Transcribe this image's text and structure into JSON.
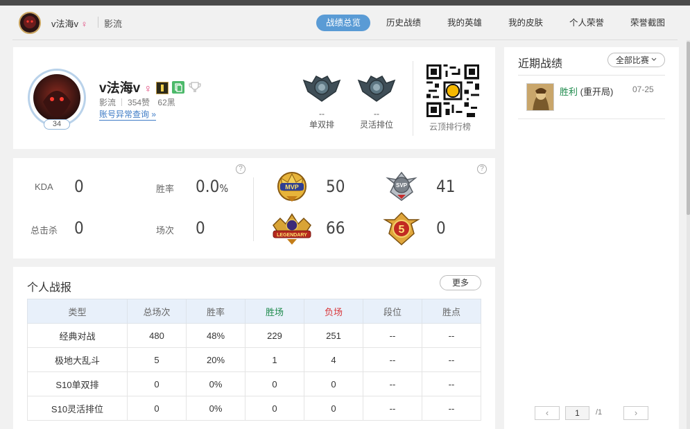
{
  "header": {
    "player_name": "v法海v",
    "gender_symbol": "♀",
    "server": "影流",
    "nav": [
      {
        "label": "战绩总览",
        "active": true
      },
      {
        "label": "历史战绩",
        "active": false
      },
      {
        "label": "我的英雄",
        "active": false
      },
      {
        "label": "我的皮肤",
        "active": false
      },
      {
        "label": "个人荣誉",
        "active": false
      },
      {
        "label": "荣誉截图",
        "active": false
      }
    ]
  },
  "profile": {
    "name": "v法海v",
    "gender_symbol": "♀",
    "level": "34",
    "server": "影流",
    "likes": "354赞",
    "dislikes": "62黑",
    "link_text": "账号异常查询",
    "link_arrow": "»",
    "solo_rank_value": "--",
    "solo_rank_label": "单双排",
    "flex_rank_value": "--",
    "flex_rank_label": "灵活排位",
    "qr_label": "云顶排行榜"
  },
  "stats": {
    "kda_label": "KDA",
    "kda_value": "0",
    "winrate_label": "胜率",
    "winrate_value": "0.0",
    "winrate_unit": "%",
    "kills_label": "总击杀",
    "kills_value": "0",
    "games_label": "场次",
    "games_value": "0",
    "help": "?",
    "mvp_count": "50",
    "svp_count": "41",
    "legendary_count": "66",
    "penta_count": "0",
    "mvp_badge_text": "MVP",
    "svp_badge_text": "SVP",
    "legendary_badge_text": "LEGENDARY",
    "penta_badge_text": "5"
  },
  "report": {
    "title": "个人战报",
    "more_label": "更多",
    "columns": [
      "类型",
      "总场次",
      "胜率",
      "胜场",
      "负场",
      "段位",
      "胜点"
    ],
    "rows": [
      [
        "经典对战",
        "480",
        "48%",
        "229",
        "251",
        "--",
        "--"
      ],
      [
        "极地大乱斗",
        "5",
        "20%",
        "1",
        "4",
        "--",
        "--"
      ],
      [
        "S10单双排",
        "0",
        "0%",
        "0",
        "0",
        "--",
        "--"
      ],
      [
        "S10灵活排位",
        "0",
        "0%",
        "0",
        "0",
        "--",
        "--"
      ]
    ],
    "win_color": "#1e8a4c",
    "loss_color": "#d9373a"
  },
  "recent": {
    "title": "近期战绩",
    "filter_label": "全部比赛",
    "filter_icon": "chevron-down-icon",
    "matches": [
      {
        "result": "胜利",
        "mode": "(重开局)",
        "date": "07-25"
      }
    ],
    "pagination": {
      "prev": "‹",
      "current": "1",
      "total": "/1",
      "next": "›"
    }
  },
  "colors": {
    "accent": "#5a9bd5",
    "link": "#3f7cc6"
  }
}
